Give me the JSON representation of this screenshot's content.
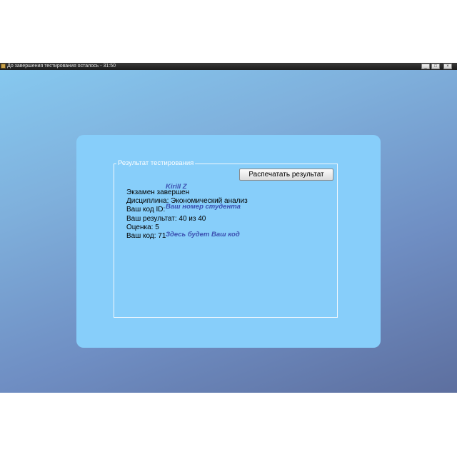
{
  "window": {
    "title": "До завершения тестирования осталось - 31:50",
    "minimize_label": "_",
    "maximize_label": "□",
    "close_label": "×"
  },
  "results": {
    "group_title": "Результат тестирования",
    "print_button": "Распечатать результат",
    "lines": [
      "Экзамен завершен",
      "Дисциплина: Экономический анализ",
      "Ваш код ID:",
      "Ваш результат: 40 из 40",
      "Оценка: 5",
      "Ваш код: 71"
    ]
  },
  "annotations": {
    "name": "Kirill Z",
    "student_number": "Ваш номер студента",
    "code_hint": "Здесь будет Ваш код"
  }
}
